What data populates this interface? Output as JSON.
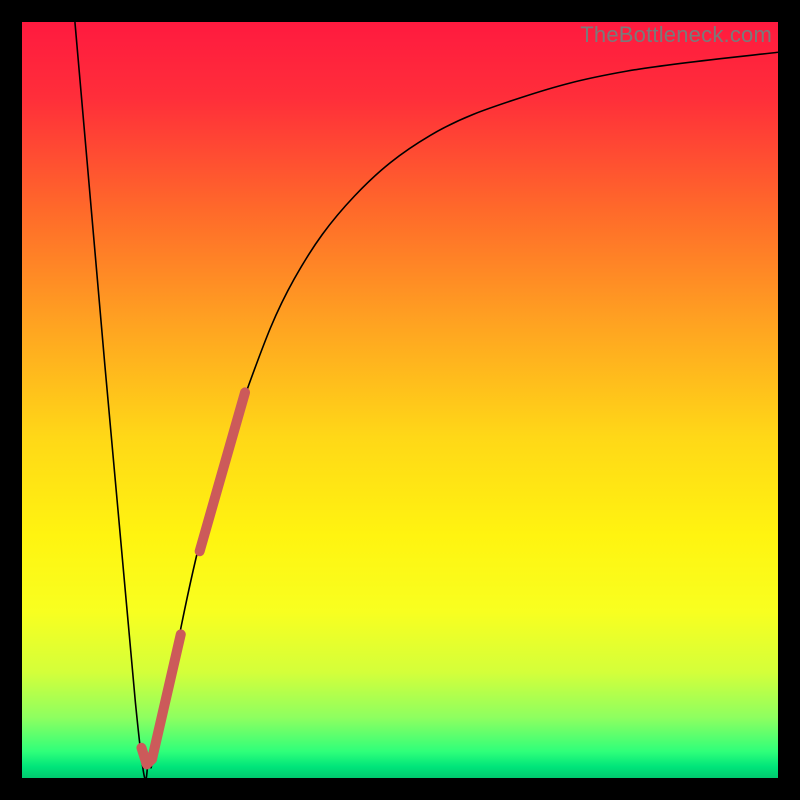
{
  "watermark": "TheBottleneck.com",
  "chart_data": {
    "type": "line",
    "title": "",
    "xlabel": "",
    "ylabel": "",
    "xlim": [
      0,
      100
    ],
    "ylim": [
      0,
      100
    ],
    "background_gradient": {
      "stops": [
        {
          "offset": 0.0,
          "color": "#ff1a3f"
        },
        {
          "offset": 0.1,
          "color": "#ff2e3a"
        },
        {
          "offset": 0.25,
          "color": "#ff6a2a"
        },
        {
          "offset": 0.4,
          "color": "#ffa321"
        },
        {
          "offset": 0.55,
          "color": "#ffd817"
        },
        {
          "offset": 0.68,
          "color": "#fff410"
        },
        {
          "offset": 0.78,
          "color": "#f8ff20"
        },
        {
          "offset": 0.86,
          "color": "#d4ff3a"
        },
        {
          "offset": 0.92,
          "color": "#8eff60"
        },
        {
          "offset": 0.965,
          "color": "#2fff7a"
        },
        {
          "offset": 0.985,
          "color": "#00e57a"
        },
        {
          "offset": 1.0,
          "color": "#00c96f"
        }
      ]
    },
    "series": [
      {
        "name": "bottleneck-curve",
        "stroke": "#000000",
        "stroke_width": 1.6,
        "points": [
          {
            "x": 7.0,
            "y": 100.0
          },
          {
            "x": 15.0,
            "y": 10.0
          },
          {
            "x": 16.8,
            "y": 2.0
          },
          {
            "x": 17.5,
            "y": 3.5
          },
          {
            "x": 20.0,
            "y": 15.0
          },
          {
            "x": 24.0,
            "y": 33.0
          },
          {
            "x": 30.0,
            "y": 52.0
          },
          {
            "x": 36.0,
            "y": 66.0
          },
          {
            "x": 44.0,
            "y": 77.0
          },
          {
            "x": 54.0,
            "y": 85.0
          },
          {
            "x": 66.0,
            "y": 90.0
          },
          {
            "x": 80.0,
            "y": 93.5
          },
          {
            "x": 100.0,
            "y": 96.0
          }
        ]
      },
      {
        "name": "highlight-upper-segment",
        "stroke": "#cc5a5a",
        "stroke_width": 10,
        "linecap": "round",
        "points": [
          {
            "x": 23.5,
            "y": 30.0
          },
          {
            "x": 29.5,
            "y": 51.0
          }
        ]
      },
      {
        "name": "highlight-lower-segment",
        "stroke": "#cc5a5a",
        "stroke_width": 10,
        "linecap": "round",
        "points": [
          {
            "x": 17.2,
            "y": 2.5
          },
          {
            "x": 21.0,
            "y": 19.0
          }
        ]
      },
      {
        "name": "highlight-hook",
        "stroke": "#cc5a5a",
        "stroke_width": 10,
        "linecap": "round",
        "points": [
          {
            "x": 15.8,
            "y": 4.0
          },
          {
            "x": 16.5,
            "y": 1.8
          },
          {
            "x": 17.2,
            "y": 2.5
          }
        ]
      }
    ]
  }
}
